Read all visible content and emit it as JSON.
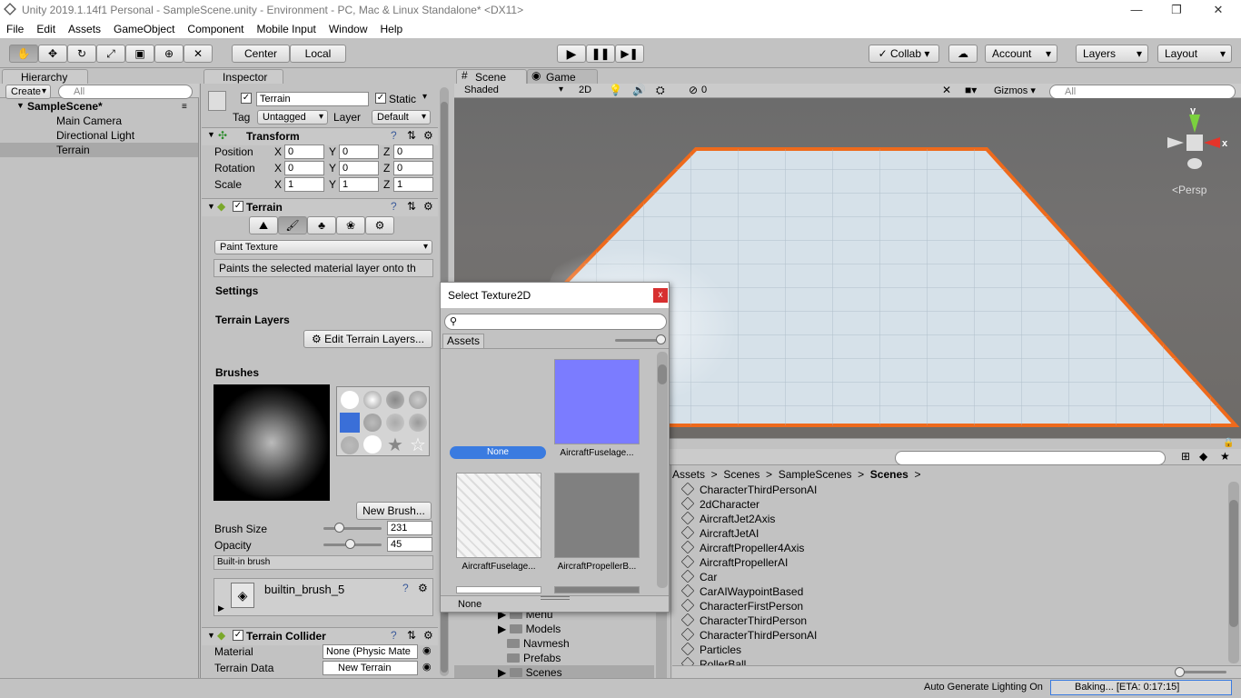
{
  "window": {
    "title": "Unity 2019.1.14f1 Personal - SampleScene.unity - Environment - PC, Mac & Linux Standalone* <DX11>",
    "minimize": "—",
    "restore": "❐",
    "close": "✕"
  },
  "menu": [
    "File",
    "Edit",
    "Assets",
    "GameObject",
    "Component",
    "Mobile Input",
    "Window",
    "Help"
  ],
  "toolbar": {
    "pivot": "Center",
    "space": "Local",
    "collab": "Collab",
    "account": "Account",
    "layers": "Layers",
    "layout": "Layout"
  },
  "hierarchy": {
    "tab": "Hierarchy",
    "create": "Create",
    "search_placeholder": "All",
    "scene": "SampleScene*",
    "items": [
      "Main Camera",
      "Directional Light",
      "Terrain"
    ]
  },
  "inspector": {
    "tab": "Inspector",
    "object_name": "Terrain",
    "static_label": "Static",
    "tag_label": "Tag",
    "tag_value": "Untagged",
    "layer_label": "Layer",
    "layer_value": "Default",
    "transform": {
      "title": "Transform",
      "rows": [
        {
          "label": "Position",
          "x": "0",
          "y": "0",
          "z": "0"
        },
        {
          "label": "Rotation",
          "x": "0",
          "y": "0",
          "z": "0"
        },
        {
          "label": "Scale",
          "x": "1",
          "y": "1",
          "z": "1"
        }
      ]
    },
    "terrain": {
      "title": "Terrain",
      "mode": "Paint Texture",
      "description": "Paints the selected material layer onto th",
      "settings": "Settings",
      "layers": "Terrain Layers",
      "edit_layers": "Edit Terrain Layers...",
      "brushes": "Brushes",
      "new_brush": "New Brush...",
      "brush_size_label": "Brush Size",
      "brush_size": "231",
      "brush_size_fraction": 0.26,
      "opacity_label": "Opacity",
      "opacity": "45",
      "opacity_fraction": 0.45,
      "builtin_label": "Built-in brush",
      "builtin_name": "builtin_brush_5"
    },
    "collider": {
      "title": "Terrain Collider",
      "material_label": "Material",
      "material_value": "None (Physic Mate",
      "data_label": "Terrain Data",
      "data_value": "New Terrain"
    }
  },
  "scene": {
    "tab_scene": "Scene",
    "tab_game": "Game",
    "shading": "Shaded",
    "mode2d": "2D",
    "hidden_count": "0",
    "gizmos": "Gizmos",
    "search_placeholder": "All",
    "persp": "Persp",
    "axis_y": "y",
    "axis_x": "x"
  },
  "dialog": {
    "title": "Select Texture2D",
    "close": "x",
    "tab": "Assets",
    "items": [
      {
        "label": "None",
        "color": "#777777"
      },
      {
        "label": "AircraftFuselage...",
        "color": "#7b7cff"
      },
      {
        "label": "AircraftFuselage...",
        "color": "#f2f2f2"
      },
      {
        "label": "AircraftPropellerB...",
        "color": "#808080"
      }
    ],
    "footer": "None"
  },
  "project": {
    "breadcrumb": [
      "Assets",
      "Scenes",
      "SampleScenes",
      "Scenes"
    ],
    "folders": [
      "Menu",
      "Models",
      "Navmesh",
      "Prefabs",
      "Scenes"
    ],
    "files": [
      "CharacterThirdPersonAI",
      "2dCharacter",
      "AircraftJet2Axis",
      "AircraftJetAI",
      "AircraftPropeller4Axis",
      "AircraftPropellerAI",
      "Car",
      "CarAIWaypointBased",
      "CharacterFirstPerson",
      "CharacterThirdPerson",
      "CharacterThirdPersonAI",
      "Particles",
      "RollerBall"
    ]
  },
  "status": {
    "lighting": "Auto Generate Lighting On",
    "baking": "Baking... [ETA: 0:17:15]"
  }
}
